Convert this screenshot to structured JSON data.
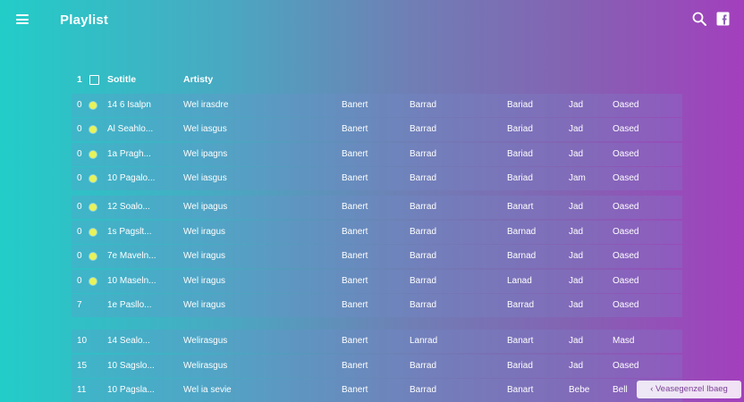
{
  "app": {
    "title": "Playlist"
  },
  "icons": {
    "menu": "menu-icon",
    "search": "search-icon",
    "share": "share-icon"
  },
  "colors": {
    "gradient_start": "#22cdc8",
    "gradient_end": "#a33fbd",
    "dot": "#e8f35a"
  },
  "table": {
    "header": {
      "num": "1",
      "title": "Sotitle",
      "artist": "Artisty"
    },
    "rows": [
      {
        "num": "0",
        "title": "14 6 Isalpn",
        "artist": "Wel irasdre",
        "album": "Banert",
        "genre": "Barrad",
        "year": "Bariad",
        "dur": "Jad",
        "plays": "Oased"
      },
      {
        "num": "0",
        "title": "Al Seahlo...",
        "artist": "Wel iasgus",
        "album": "Banert",
        "genre": "Barrad",
        "year": "Bariad",
        "dur": "Jad",
        "plays": "Oased"
      },
      {
        "num": "0",
        "title": "1a Pragh...",
        "artist": "Wel ipagns",
        "album": "Banert",
        "genre": "Barrad",
        "year": "Bariad",
        "dur": "Jad",
        "plays": "Oased"
      },
      {
        "num": "0",
        "title": "10 Pagalo...",
        "artist": "Wel iasgus",
        "album": "Banert",
        "genre": "Barrad",
        "year": "Bariad",
        "dur": "Jam",
        "plays": "Oased"
      },
      {
        "num": "0",
        "title": "12 Soalo...",
        "artist": "Wel ipagus",
        "album": "Banert",
        "genre": "Barrad",
        "year": "Banart",
        "dur": "Jad",
        "plays": "Oased"
      },
      {
        "num": "0",
        "title": "1s Pagslt...",
        "artist": "Wel iragus",
        "album": "Banert",
        "genre": "Barrad",
        "year": "Barnad",
        "dur": "Jad",
        "plays": "Oased"
      },
      {
        "num": "0",
        "title": "7e Maveln...",
        "artist": "Wel iragus",
        "album": "Banert",
        "genre": "Barrad",
        "year": "Barnad",
        "dur": "Jad",
        "plays": "Oased"
      },
      {
        "num": "0",
        "title": "10 Maseln...",
        "artist": "Wel iragus",
        "album": "Banert",
        "genre": "Barrad",
        "year": "Lanad",
        "dur": "Jad",
        "plays": "Oased"
      },
      {
        "num": "7",
        "title": "1e Pasllo...",
        "artist": "Wel iragus",
        "album": "Banert",
        "genre": "Barrad",
        "year": "Barrad",
        "dur": "Jad",
        "plays": "Oased"
      },
      {
        "num": "10",
        "title": "14 Sealo...",
        "artist": "Welirasgus",
        "album": "Banert",
        "genre": "Lanrad",
        "year": "Banart",
        "dur": "Jad",
        "plays": "Masd"
      },
      {
        "num": "15",
        "title": "10 Sagslo...",
        "artist": "Welirasgus",
        "album": "Banert",
        "genre": "Barrad",
        "year": "Bariad",
        "dur": "Jad",
        "plays": "Oased"
      },
      {
        "num": "11",
        "title": "10 Pagsla...",
        "artist": "Wel ia sevie",
        "album": "Banert",
        "genre": "Barrad",
        "year": "Banart",
        "dur": "Bebe",
        "plays": "Bell"
      }
    ]
  },
  "toast": {
    "label": "‹ Veasegenzel Ibaeg"
  }
}
